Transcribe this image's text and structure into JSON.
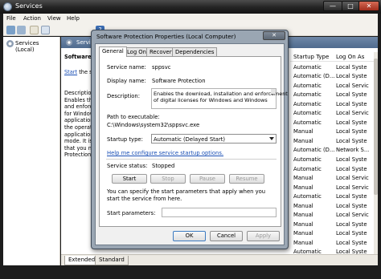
{
  "window": {
    "title": "Services",
    "controls": {
      "minimize": "—",
      "maximize": "□",
      "close": "✕"
    }
  },
  "menubar": [
    "File",
    "Action",
    "View",
    "Help"
  ],
  "toolbar": {
    "help_glyph": "?"
  },
  "tree": {
    "root_label": "Services (Local)"
  },
  "content": {
    "header_title": "Services",
    "selected_service_name": "Software P",
    "start_link_text": "Start",
    "start_suffix": " the service",
    "description_label": "Description:",
    "description_lines": [
      "Enables the",
      "and enforce",
      "for Window",
      "applications",
      "the operating",
      "applications",
      "mode. It is",
      "that you not",
      "Protection service"
    ],
    "columns": {
      "startup": "Startup Type",
      "logon": "Log On As"
    },
    "rows": [
      {
        "startup": "Automatic",
        "logon": "Local Syste"
      },
      {
        "startup": "Automatic (D...",
        "logon": "Local Syste"
      },
      {
        "startup": "Automatic",
        "logon": "Local Servic"
      },
      {
        "startup": "Automatic",
        "logon": "Local Syste"
      },
      {
        "startup": "Automatic",
        "logon": "Local Syste"
      },
      {
        "startup": "Automatic",
        "logon": "Local Servic"
      },
      {
        "startup": "Automatic",
        "logon": "Local Syste"
      },
      {
        "startup": "Manual",
        "logon": "Local Syste"
      },
      {
        "startup": "Manual",
        "logon": "Local Syste"
      },
      {
        "startup": "Automatic (D...",
        "logon": "Network S..."
      },
      {
        "startup": "Automatic",
        "logon": "Local Syste"
      },
      {
        "startup": "Automatic",
        "logon": "Local Syste"
      },
      {
        "startup": "Manual",
        "logon": "Local Servic"
      },
      {
        "startup": "Manual",
        "logon": "Local Servic"
      },
      {
        "startup": "Automatic",
        "logon": "Local Syste"
      },
      {
        "startup": "Manual",
        "logon": "Local Syste"
      },
      {
        "startup": "Manual",
        "logon": "Local Servic"
      },
      {
        "startup": "Manual",
        "logon": "Local Syste"
      },
      {
        "startup": "Manual",
        "logon": "Local Syste"
      },
      {
        "startup": "Manual",
        "logon": "Local Syste"
      },
      {
        "startup": "Automatic",
        "logon": "Local Syste"
      },
      {
        "startup": "Automatic",
        "logon": "Network S..."
      }
    ]
  },
  "bottom_tabs": {
    "extended": "Extended",
    "standard": "Standard"
  },
  "dialog": {
    "title": "Software Protection Properties (Local Computer)",
    "close_glyph": "✕",
    "tabs": {
      "general": "General",
      "logon": "Log On",
      "recovery": "Recovery",
      "dependencies": "Dependencies"
    },
    "service_name_label": "Service name:",
    "service_name": "sppsvc",
    "display_name_label": "Display name:",
    "display_name": "Software Protection",
    "description_label": "Description:",
    "description_lines": [
      "Enables the download, installation and enforcement",
      "of digital licenses for Windows and Windows"
    ],
    "path_label": "Path to executable:",
    "path": "C:\\Windows\\system32\\sppsvc.exe",
    "startup_type_label": "Startup type:",
    "startup_type": "Automatic (Delayed Start)",
    "help_link": "Help me configure service startup options.",
    "status_label": "Service status:",
    "status": "Stopped",
    "buttons": {
      "start": "Start",
      "stop": "Stop",
      "pause": "Pause",
      "resume": "Resume"
    },
    "start_params_note": "You can specify the start parameters that apply when you start the service from here.",
    "start_params_label": "Start parameters:",
    "start_params_value": "",
    "footer": {
      "ok": "OK",
      "cancel": "Cancel",
      "apply": "Apply"
    }
  }
}
